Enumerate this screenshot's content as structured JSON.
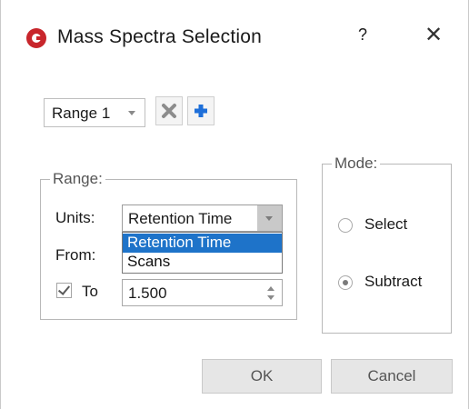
{
  "window": {
    "title": "Mass Spectra Selection",
    "help_label": "?",
    "close_label": "✕",
    "app_icon": "app-logo-icon"
  },
  "range_selector": {
    "selected": "Range 1",
    "remove_icon": "remove-range-icon",
    "add_icon": "add-range-icon"
  },
  "range_group": {
    "legend": "Range:",
    "units_label": "Units:",
    "units_value": "Retention Time",
    "units_options": [
      "Retention Time",
      "Scans"
    ],
    "from_label": "From:",
    "to_checkbox_label": "To",
    "to_checked": true,
    "to_value": "1.500"
  },
  "mode_group": {
    "legend": "Mode:",
    "options": [
      {
        "label": "Select",
        "checked": false
      },
      {
        "label": "Subtract",
        "checked": true
      }
    ]
  },
  "buttons": {
    "ok": "OK",
    "cancel": "Cancel"
  },
  "colors": {
    "app_icon": "#c8262c",
    "add_icon": "#1e6fd9",
    "remove_icon": "#8c8c8c",
    "selection": "#1e73c9"
  }
}
